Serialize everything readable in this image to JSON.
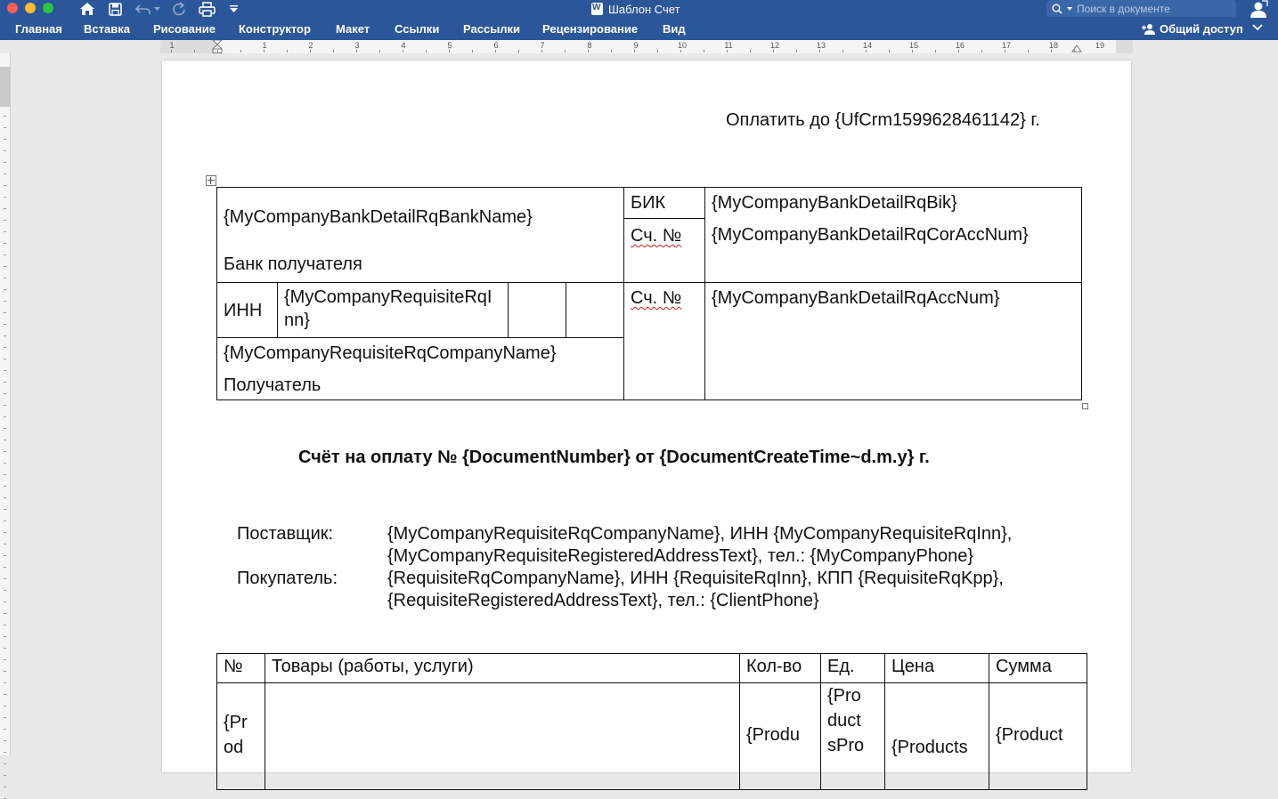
{
  "window": {
    "title": "Шаблон Счет",
    "search_placeholder": "Поиск в документе"
  },
  "ribbon": {
    "tabs": [
      "Главная",
      "Вставка",
      "Рисование",
      "Конструктор",
      "Макет",
      "Ссылки",
      "Рассылки",
      "Рецензирование",
      "Вид"
    ],
    "share_label": "Общий доступ"
  },
  "ruler": {
    "labels": [
      "1",
      "1",
      "2",
      "3",
      "4",
      "5",
      "6",
      "7",
      "8",
      "9",
      "10",
      "11",
      "12",
      "13",
      "14",
      "15",
      "16",
      "17",
      "18",
      "19"
    ]
  },
  "document": {
    "pay_until": "Оплатить до {UfCrm1599628461142} г.",
    "bank_table": {
      "bank_name": "{MyCompanyBankDetailRqBankName}",
      "bank_caption": "Банк получателя",
      "bik_label": "БИК",
      "bik_value": "{MyCompanyBankDetailRqBik}",
      "cor_acc_label": "Сч. №",
      "cor_acc_value": "{MyCompanyBankDetailRqCorAccNum}",
      "inn_label": "ИНН",
      "inn_value": "{MyCompanyRequisiteRqInn}",
      "acc_label": "Сч. №",
      "acc_value": "{MyCompanyBankDetailRqAccNum}",
      "company_name": "{MyCompanyRequisiteRqCompanyName}",
      "recipient_caption": "Получатель"
    },
    "invoice_title": "Счёт на оплату № {DocumentNumber} от {DocumentCreateTime~d.m.y} г.",
    "supplier_label": "Поставщик:",
    "supplier_line1": "{MyCompanyRequisiteRqCompanyName}, ИНН {MyCompanyRequisiteRqInn},",
    "supplier_line2": "{MyCompanyRequisiteRegisteredAddressText}, тел.: {MyCompanyPhone}",
    "buyer_label": "Покупатель:",
    "buyer_line1": "{RequisiteRqCompanyName}, ИНН {RequisiteRqInn}, КПП {RequisiteRqKpp},",
    "buyer_line2": "{RequisiteRegisteredAddressText}, тел.: {ClientPhone}",
    "goods_table": {
      "headers": [
        "№",
        "Товары (работы, услуги)",
        "Кол-во",
        "Ед.",
        "Цена",
        "Сумма"
      ],
      "row": {
        "num_l1": "{Pr",
        "num_l2": "od",
        "qty_l1": "{Produ",
        "unit_l1": "{Pro",
        "unit_l2": "duct",
        "unit_l3": "sPro",
        "price_l1": "{Products",
        "sum_l1": "{Product"
      }
    }
  },
  "colors": {
    "ribbon": "#2b579a",
    "page": "#ffffff",
    "spellcheck": "#d02020"
  }
}
